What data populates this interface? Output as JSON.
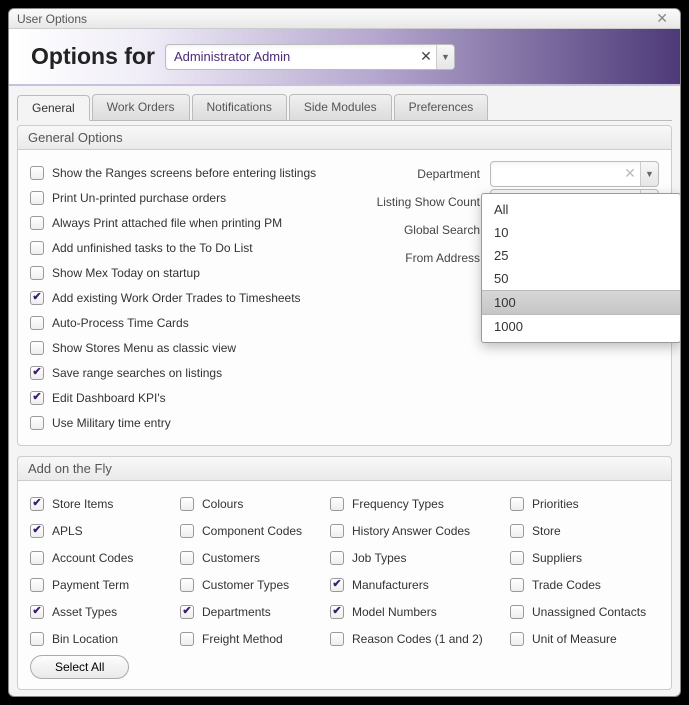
{
  "window_title": "User Options",
  "header": {
    "title": "Options for",
    "user_value": "Administrator Admin"
  },
  "tabs": [
    "General",
    "Work Orders",
    "Notifications",
    "Side Modules",
    "Preferences"
  ],
  "active_tab": 0,
  "general_section_title": "General Options",
  "general_checks": [
    {
      "label": "Show the Ranges screens before entering listings",
      "checked": false
    },
    {
      "label": "Print Un-printed purchase orders",
      "checked": false
    },
    {
      "label": "Always Print attached file when printing PM",
      "checked": false
    },
    {
      "label": "Add unfinished tasks to the To Do List",
      "checked": false
    },
    {
      "label": "Show Mex Today on startup",
      "checked": false
    },
    {
      "label": "Add existing Work Order Trades to Timesheets",
      "checked": true
    },
    {
      "label": "Auto-Process Time Cards",
      "checked": false
    },
    {
      "label": "Show Stores Menu as classic view",
      "checked": false
    },
    {
      "label": "Save range searches on listings",
      "checked": true
    },
    {
      "label": "Edit Dashboard KPI's",
      "checked": true
    },
    {
      "label": "Use Military time entry",
      "checked": false
    }
  ],
  "right_fields": {
    "department_label": "Department",
    "department_value": "",
    "listing_label": "Listing Show Count",
    "listing_value": "100",
    "global_label": "Global Search",
    "global_checked": true,
    "from_label": "From Address"
  },
  "listing_options": [
    "All",
    "10",
    "25",
    "50",
    "100",
    "1000"
  ],
  "listing_selected_index": 4,
  "fly_section_title": "Add on the Fly",
  "fly_columns": [
    [
      {
        "label": "Store Items",
        "checked": true
      },
      {
        "label": "APLS",
        "checked": true
      },
      {
        "label": "Account Codes",
        "checked": false
      },
      {
        "label": "Payment Term",
        "checked": false
      },
      {
        "label": "Asset Types",
        "checked": true
      },
      {
        "label": "Bin Location",
        "checked": false
      }
    ],
    [
      {
        "label": "Colours",
        "checked": false
      },
      {
        "label": "Component Codes",
        "checked": false
      },
      {
        "label": "Customers",
        "checked": false
      },
      {
        "label": "Customer Types",
        "checked": false
      },
      {
        "label": "Departments",
        "checked": true
      },
      {
        "label": "Freight Method",
        "checked": false
      }
    ],
    [
      {
        "label": "Frequency Types",
        "checked": false
      },
      {
        "label": "History Answer Codes",
        "checked": false
      },
      {
        "label": "Job Types",
        "checked": false
      },
      {
        "label": "Manufacturers",
        "checked": true
      },
      {
        "label": "Model Numbers",
        "checked": true
      },
      {
        "label": "Reason Codes (1 and 2)",
        "checked": false
      }
    ],
    [
      {
        "label": "Priorities",
        "checked": false
      },
      {
        "label": "Store",
        "checked": false
      },
      {
        "label": "Suppliers",
        "checked": false
      },
      {
        "label": "Trade Codes",
        "checked": false
      },
      {
        "label": "Unassigned Contacts",
        "checked": false
      },
      {
        "label": "Unit of Measure",
        "checked": false
      }
    ]
  ],
  "select_all_label": "Select All"
}
